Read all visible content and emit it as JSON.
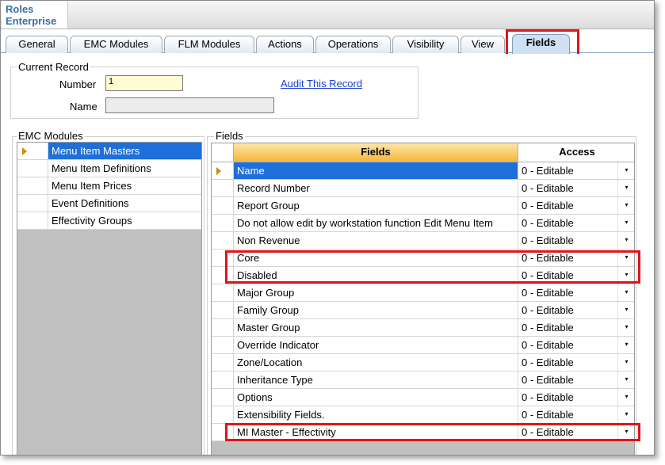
{
  "app": {
    "title_line1": "Roles",
    "title_line2": "Enterprise"
  },
  "tabs": [
    {
      "label": "General"
    },
    {
      "label": "EMC Modules"
    },
    {
      "label": "FLM Modules"
    },
    {
      "label": "Actions"
    },
    {
      "label": "Operations"
    },
    {
      "label": "Visibility"
    },
    {
      "label": "View"
    },
    {
      "label": "Fields",
      "active": true
    }
  ],
  "current_record": {
    "group_label": "Current Record",
    "number_label": "Number",
    "number_value": "1",
    "name_label": "Name",
    "name_value": "",
    "audit_link": "Audit This Record"
  },
  "emc_modules": {
    "group_label": "EMC Modules",
    "items": [
      {
        "label": "Menu Item Masters",
        "selected": true
      },
      {
        "label": "Menu Item Definitions"
      },
      {
        "label": "Menu Item Prices"
      },
      {
        "label": "Event Definitions"
      },
      {
        "label": "Effectivity Groups"
      }
    ]
  },
  "fields": {
    "group_label": "Fields",
    "col_fields": "Fields",
    "col_access": "Access",
    "dropdown_glyph": "▾",
    "rows": [
      {
        "name": "Name",
        "access": "0 - Editable",
        "selected": true
      },
      {
        "name": "Record Number",
        "access": "0 - Editable"
      },
      {
        "name": "Report Group",
        "access": "0 - Editable"
      },
      {
        "name": "Do not allow edit by workstation function Edit Menu Item",
        "access": "0 - Editable"
      },
      {
        "name": "Non Revenue",
        "access": "0 - Editable"
      },
      {
        "name": "Core",
        "access": "0 - Editable"
      },
      {
        "name": "Disabled",
        "access": "0 - Editable"
      },
      {
        "name": "Major Group",
        "access": "0 - Editable"
      },
      {
        "name": "Family Group",
        "access": "0 - Editable"
      },
      {
        "name": "Master Group",
        "access": "0 - Editable"
      },
      {
        "name": "Override Indicator",
        "access": "0 - Editable"
      },
      {
        "name": "Zone/Location",
        "access": "0 - Editable"
      },
      {
        "name": "Inheritance Type",
        "access": "0 - Editable"
      },
      {
        "name": "Options",
        "access": "0 - Editable"
      },
      {
        "name": "Extensibility Fields.",
        "access": "0 - Editable"
      },
      {
        "name": "MI Master - Effectivity",
        "access": "0 - Editable"
      }
    ]
  },
  "colors": {
    "highlight": "#e0141a",
    "selection": "#1e6fd9",
    "header_orange": "#f6b53a"
  }
}
